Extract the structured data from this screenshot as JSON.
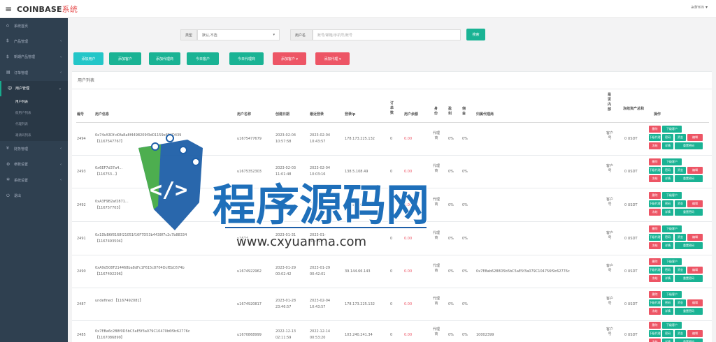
{
  "header": {
    "brand": "COINBASE",
    "brand_suffix": "系统",
    "user": "admin"
  },
  "sidebar": {
    "items": [
      {
        "label": "系统首页",
        "icon": "home-icon",
        "active": false
      },
      {
        "label": "产品管理",
        "icon": "product-icon",
        "active": false
      },
      {
        "label": "新期产品管理",
        "icon": "product-icon",
        "active": false
      },
      {
        "label": "订单管理",
        "icon": "order-icon",
        "active": false
      },
      {
        "label": "用户管理",
        "icon": "user-icon",
        "active": true
      },
      {
        "label": "财务管理",
        "icon": "finance-icon",
        "active": false
      },
      {
        "label": "参数设置",
        "icon": "settings-icon",
        "active": false
      },
      {
        "label": "系统设置",
        "icon": "gear-icon",
        "active": false
      },
      {
        "label": "退出",
        "icon": "logout-icon",
        "active": false
      }
    ],
    "subitems": [
      "用户列表",
      "假用户列表",
      "代理列表",
      "邀请码列表"
    ]
  },
  "filters": {
    "type_label": "类型",
    "type_value": "默认,不选",
    "user_label": "用户名",
    "user_placeholder": "账号/邮箱/手机号/账号",
    "search_button": "搜索"
  },
  "actions": [
    {
      "label": "添加用户",
      "color": "#23c6c8"
    },
    {
      "label": "添加客户",
      "color": "#1ab394"
    },
    {
      "label": "添加代理商",
      "color": "#1ab394"
    },
    {
      "label": "今日客户",
      "color": "#1ab394"
    },
    {
      "label": "今日代理商",
      "color": "#1ab394"
    },
    {
      "label": "添加客户 ▾",
      "color": "#ed5565"
    },
    {
      "label": "添加代理 ▾",
      "color": "#ed5565"
    }
  ],
  "panel": {
    "title": "用户列表"
  },
  "columns": {
    "id": "编号",
    "info": "用户信息",
    "name": "用户名称",
    "created": "创建日期",
    "last_login": "最近登录",
    "ip": "登录ip",
    "orders": "订单数",
    "balance": "用户余额",
    "role": "身份",
    "profit": "盈利",
    "deposit": "佣金",
    "agent": "归属代理商",
    "internal": "是否内部",
    "fund": "冻结资产总和",
    "ops": "操作"
  },
  "row_defaults": {
    "orders": "0",
    "balance": "0.00",
    "role": "代理商",
    "profit": "0%",
    "deposit": "0%",
    "internal": "客户号",
    "fund": "0 USDT"
  },
  "rows": [
    {
      "id": "2494",
      "info1": "0x74cA3Df-d0fa8a8f4498209f3d01159e6F4D439",
      "info2": "【1167547767】",
      "name": "u1675477679",
      "created1": "2023-02-04",
      "created2": "10:57:58",
      "login1": "2023-02-04",
      "login2": "10:43:57",
      "ip": "178.173.225.132",
      "agent": ""
    },
    {
      "id": "2493",
      "info1": "0x6EF7d37a4...",
      "info2": "【116753...】",
      "name": "u1675352303",
      "created1": "2023-02-03",
      "created2": "11:01:48",
      "login1": "2023-02-04",
      "login2": "10:03:16",
      "ip": "138.5.108.49",
      "agent": ""
    },
    {
      "id": "2492",
      "info1": "0xA3F9B2af2871...",
      "info2": "【116757703】",
      "name": "",
      "created1": "",
      "created2": "",
      "login1": "2023-02-03",
      "login2": "",
      "ip": "138.5.106.86",
      "agent": ""
    },
    {
      "id": "2491",
      "info1": "0x1DbB6f8168f21051f16F7D53b4438f7c2c7b88334",
      "info2": "【1167493504】",
      "name": "u1674...",
      "created1": "2023-01-31",
      "created2": "",
      "login1": "2023-01-",
      "login2": "00:44:1",
      "ip": "",
      "agent": ""
    },
    {
      "id": "2490",
      "info1": "0xA9d508F214468ba8dFc1F615c8704DcfEbC674b",
      "info2": "【1167492296】",
      "name": "u1674922962",
      "created1": "2023-01-29",
      "created2": "00:02:42",
      "login1": "2023-01-29",
      "login2": "00:42:01",
      "ip": "39.144.66.143",
      "agent": "0x7E8ab6288D5b5bC5aE5f3a079C104756f9c62776c"
    },
    {
      "id": "2487",
      "info1": "undefined 【1167492081】",
      "info2": "",
      "name": "u1674920817",
      "created1": "2023-01-28",
      "created2": "23:46:57",
      "login1": "2023-02-04",
      "login2": "10:43:57",
      "ip": "178.173.225.132",
      "agent": ""
    },
    {
      "id": "2485",
      "info1": "0x7EBa6c2B8f0D5bC5aE5f3a079C10470b6f9c62776c",
      "info2": "【1167086899】",
      "name": "u1670868999",
      "created1": "2022-12-13",
      "created2": "02:11:59",
      "login1": "2022-12-14",
      "login2": "00:53:20",
      "ip": "103.240.241.34",
      "agent": "10002399"
    }
  ],
  "row_ops": {
    "delete": "删除",
    "edit": "编辑",
    "detail": "详情",
    "lower_level": "下级客户",
    "lower_agent": "下级代理",
    "password": "密码",
    "fund": "资金",
    "freeze": "冻结",
    "reset": "重置密码"
  },
  "watermark": {
    "title": "程序源码网",
    "url": "www.cxyuanma.com"
  }
}
